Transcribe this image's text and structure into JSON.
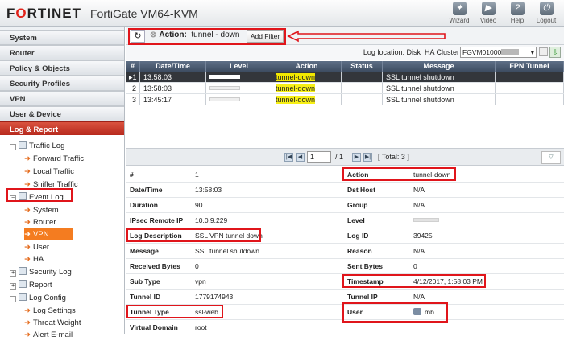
{
  "header": {
    "brand_a": "F",
    "brand_o": "O",
    "brand_b": "RTINET",
    "product": "FortiGate VM64-KVM",
    "icons": [
      {
        "label": "Wizard",
        "icon": "wand-icon"
      },
      {
        "label": "Video",
        "icon": "video-icon"
      },
      {
        "label": "Help",
        "icon": "help-icon"
      },
      {
        "label": "Logout",
        "icon": "logout-icon"
      }
    ]
  },
  "sidebar": {
    "sections": [
      "System",
      "Router",
      "Policy & Objects",
      "Security Profiles",
      "VPN",
      "User & Device",
      "Log & Report"
    ],
    "tree": {
      "traffic_log": "Traffic Log",
      "forward_traffic": "Forward Traffic",
      "local_traffic": "Local Traffic",
      "sniffer_traffic": "Sniffer Traffic",
      "event_log": "Event Log",
      "system": "System",
      "router": "Router",
      "vpn": "VPN",
      "user": "User",
      "ha": "HA",
      "security_log": "Security Log",
      "report": "Report",
      "log_config": "Log Config",
      "log_settings": "Log Settings",
      "threat_weight": "Threat Weight",
      "alert_email": "Alert E-mail"
    }
  },
  "toolbar": {
    "filter_label": "Action:",
    "filter_value": "tunnel - down",
    "add_filter": "Add Filter"
  },
  "location": {
    "text": "Log location: Disk",
    "cluster_label": "HA Cluster",
    "cluster_value": "FGVM01000"
  },
  "grid": {
    "headers": [
      "#",
      "Date/Time",
      "Level",
      "Action",
      "Status",
      "Message",
      "FPN Tunnel"
    ],
    "rows": [
      {
        "num": "1",
        "time": "13:58:03",
        "action_a": "tunnel",
        "action_b": "-down",
        "message": "SSL tunnel shutdown"
      },
      {
        "num": "2",
        "time": "13:58:03",
        "action_a": "tunnel",
        "action_b": "-down",
        "message": "SSL tunnel shutdown"
      },
      {
        "num": "3",
        "time": "13:45:17",
        "action_a": "tunnel",
        "action_b": "-down",
        "message": "SSL tunnel shutdown"
      }
    ]
  },
  "pager": {
    "page": "1",
    "of": "/ 1",
    "total": "[ Total: 3 ]"
  },
  "details": {
    "left": [
      {
        "k": "#",
        "v": "1"
      },
      {
        "k": "Date/Time",
        "v": "13:58:03"
      },
      {
        "k": "Duration",
        "v": "90"
      },
      {
        "k": "IPsec Remote IP",
        "v": "10.0.9.229"
      },
      {
        "k": "Log Description",
        "v": "SSL VPN tunnel down"
      },
      {
        "k": "Message",
        "v": "SSL tunnel shutdown"
      },
      {
        "k": "Received Bytes",
        "v": "0"
      },
      {
        "k": "Sub Type",
        "v": "vpn"
      },
      {
        "k": "Tunnel ID",
        "v": "1779174943"
      },
      {
        "k": "Tunnel Type",
        "v": "ssl-web"
      },
      {
        "k": "Virtual Domain",
        "v": "root"
      }
    ],
    "right": [
      {
        "k": "Action",
        "v": "tunnel-down"
      },
      {
        "k": "Dst Host",
        "v": "N/A"
      },
      {
        "k": "Group",
        "v": "N/A"
      },
      {
        "k": "Level",
        "v": ""
      },
      {
        "k": "Log ID",
        "v": "39425"
      },
      {
        "k": "Reason",
        "v": "N/A"
      },
      {
        "k": "Sent Bytes",
        "v": "0"
      },
      {
        "k": "Timestamp",
        "v": "4/12/2017, 1:58:03 PM"
      },
      {
        "k": "Tunnel IP",
        "v": "N/A"
      },
      {
        "k": "User",
        "v": "mb"
      },
      {
        "k": "",
        "v": ""
      }
    ]
  },
  "colors": {
    "accent_red": "#e0151b",
    "highlight": "#f7ef16",
    "selected_nav": "#f47c20"
  }
}
